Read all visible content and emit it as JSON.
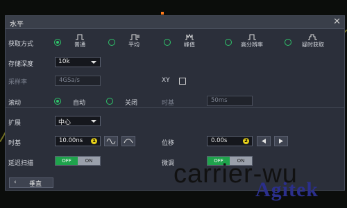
{
  "dialog": {
    "title": "水平",
    "close_glyph": "✕"
  },
  "acquisition": {
    "label": "获取方式",
    "modes": [
      {
        "label": "普通",
        "selected": true,
        "icon": "normal-mode-icon"
      },
      {
        "label": "平均",
        "selected": false,
        "icon": "average-mode-icon"
      },
      {
        "label": "峰值",
        "selected": false,
        "icon": "peak-mode-icon"
      },
      {
        "label": "高分辨率",
        "selected": false,
        "icon": "high-res-mode-icon"
      },
      {
        "label": "疑时获取",
        "selected": false,
        "icon": "ultra-acquire-icon"
      }
    ]
  },
  "memory_depth": {
    "label": "存储深度",
    "value": "10k"
  },
  "sample_rate": {
    "label": "采样率",
    "value": "4GSa/s"
  },
  "xy": {
    "label": "XY",
    "checked": false
  },
  "roll": {
    "label": "滚动",
    "auto": "自动",
    "off": "关闭",
    "selected": "auto"
  },
  "roll_timebase": {
    "label": "时基",
    "value": "50ms"
  },
  "expand": {
    "label": "扩展",
    "value": "中心"
  },
  "timebase": {
    "label": "时基",
    "value": "10.00ns",
    "badge": "1"
  },
  "position": {
    "label": "位移",
    "value": "0.00s",
    "badge": "2"
  },
  "delay_scan": {
    "label": "延迟扫描",
    "off": "OFF",
    "on": "ON",
    "state": "OFF"
  },
  "fine": {
    "label": "微调",
    "off": "OFF",
    "on": "ON",
    "state": "OFF"
  },
  "vertical_button": {
    "label": "垂直",
    "arrow": "‹"
  },
  "watermark": {
    "line1": "carrier-wu",
    "line2": "Agitek"
  },
  "colors": {
    "accent": "#2fc56b",
    "badge": "#e8d21b",
    "trace": "#c9c23a",
    "panel": "#2b2f3a"
  }
}
